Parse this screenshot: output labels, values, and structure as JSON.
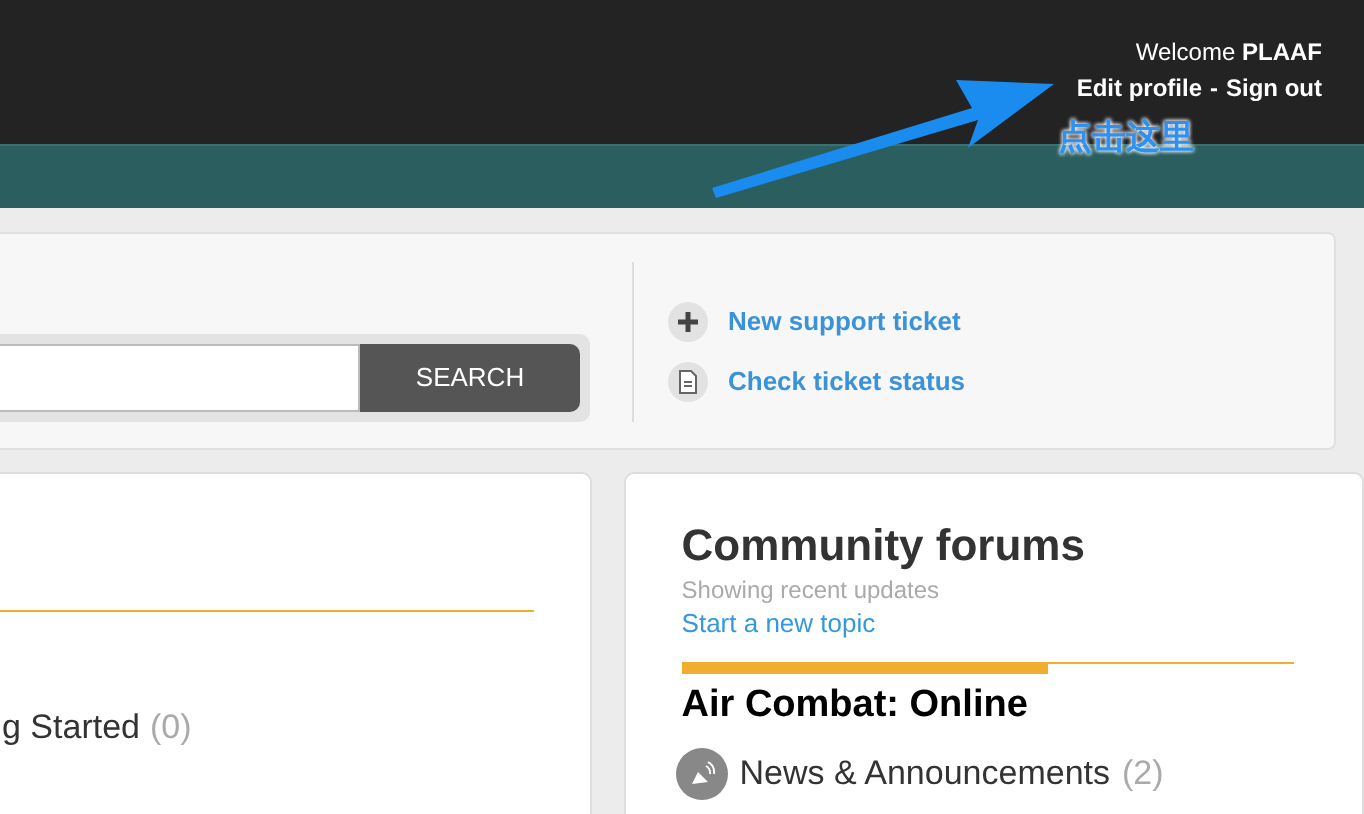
{
  "header": {
    "welcome": "Welcome **PLAAF**",
    "links": [
      "Edit profile",
      "Sign out"
    ],
    "separator": "-"
  },
  "annotation": {
    "text": "点击这里"
  },
  "search": {
    "button": "SEARCH"
  },
  "actions": [
    {
      "kind": "new",
      "label": "New support ticket"
    },
    {
      "kind": "status",
      "label": "Check ticket status"
    }
  ],
  "left_card": {
    "items": [
      {
        "label": "g Started",
        "count": "(0)"
      }
    ]
  },
  "forums": {
    "title": "Community forums",
    "subtitle": "Showing recent updates",
    "link": "Start a new topic",
    "category": "Air Combat: Online",
    "items": [
      {
        "label": "News & Announcements",
        "count": "(2)"
      }
    ]
  }
}
